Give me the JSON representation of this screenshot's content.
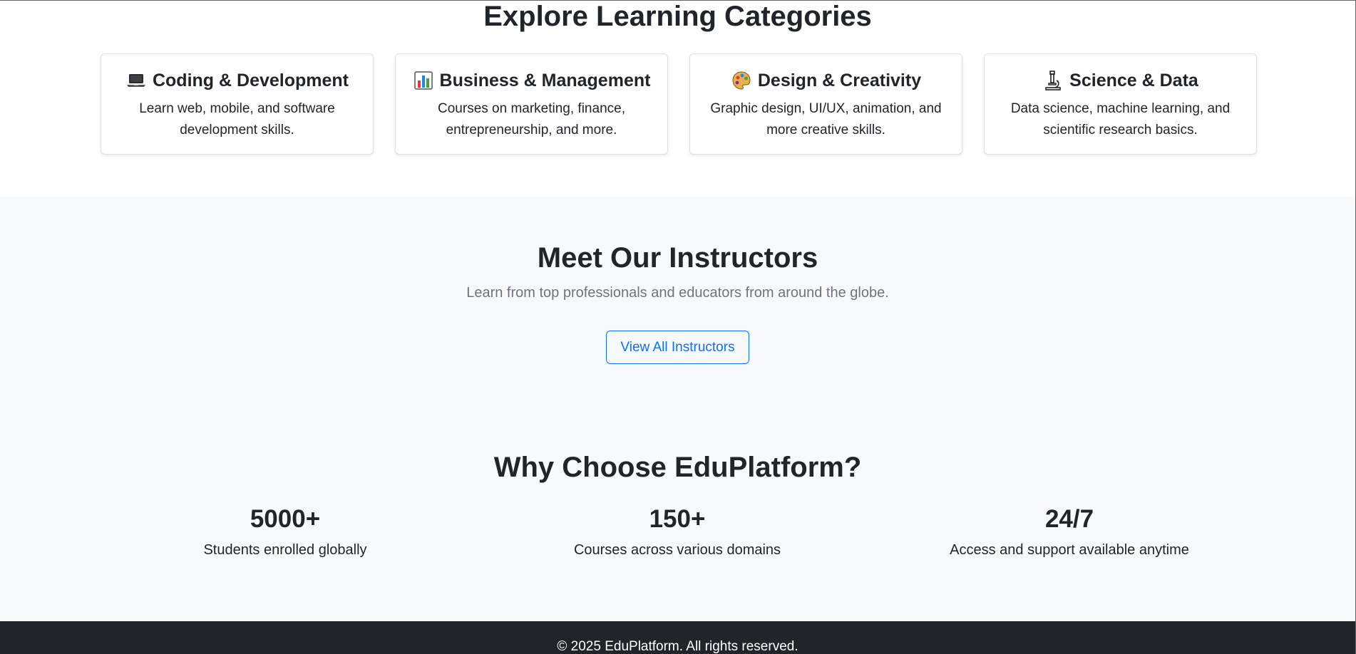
{
  "categories": {
    "heading": "Explore Learning Categories",
    "items": [
      {
        "icon": "laptop-icon",
        "title": "Coding & Development",
        "description": "Learn web, mobile, and software development skills."
      },
      {
        "icon": "bar-chart-icon",
        "title": "Business & Management",
        "description": "Courses on marketing, finance, entrepreneurship, and more."
      },
      {
        "icon": "palette-icon",
        "title": "Design & Creativity",
        "description": "Graphic design, UI/UX, animation, and more creative skills."
      },
      {
        "icon": "microscope-icon",
        "title": "Science & Data",
        "description": "Data science, machine learning, and scientific research basics."
      }
    ]
  },
  "instructors": {
    "heading": "Meet Our Instructors",
    "subheading": "Learn from top professionals and educators from around the globe.",
    "button_label": "View All Instructors"
  },
  "why": {
    "heading": "Why Choose EduPlatform?",
    "stats": [
      {
        "value": "5000+",
        "label": "Students enrolled globally"
      },
      {
        "value": "150+",
        "label": "Courses across various domains"
      },
      {
        "value": "24/7",
        "label": "Access and support available anytime"
      }
    ]
  },
  "footer": {
    "text": "© 2025 EduPlatform. All rights reserved."
  },
  "colors": {
    "primary": "#0d6efd",
    "text": "#212529",
    "muted": "#6c757d",
    "section_bg": "#f8f9fa",
    "footer_bg": "#212529"
  }
}
